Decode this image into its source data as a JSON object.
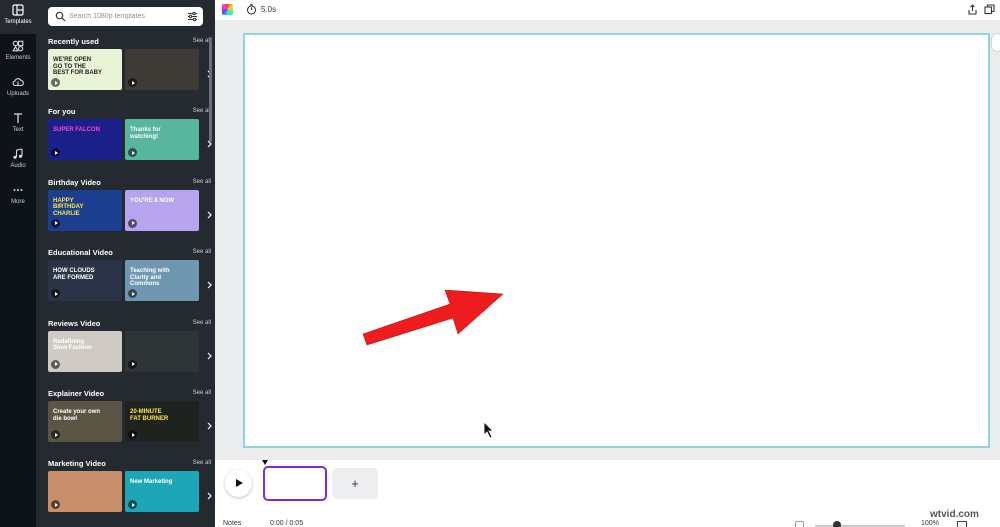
{
  "rail": {
    "items": [
      {
        "label": "Templates",
        "icon": "templates-icon"
      },
      {
        "label": "Elements",
        "icon": "elements-icon"
      },
      {
        "label": "Uploads",
        "icon": "uploads-icon"
      },
      {
        "label": "Text",
        "icon": "text-icon"
      },
      {
        "label": "Audio",
        "icon": "audio-icon"
      },
      {
        "label": "More",
        "icon": "more-icon"
      }
    ]
  },
  "search": {
    "placeholder": "Search 1080p templates"
  },
  "sections": [
    {
      "title": "Recently used",
      "see_all": "See all",
      "thumbs": [
        {
          "text": "WE'RE OPEN\nGO TO THE\nBEST FOR BABY",
          "bg": "#e9f3d6",
          "fg": "#1d1d1d"
        },
        {
          "text": "",
          "bg": "#3e3a36",
          "fg": "#fff"
        }
      ]
    },
    {
      "title": "For you",
      "see_all": "See all",
      "thumbs": [
        {
          "text": "SUPER FALCON",
          "bg": "#1b1f8a",
          "fg": "#ff44c8"
        },
        {
          "text": "Thanks for\nwatching!",
          "bg": "#57b69d",
          "fg": "#ffffff"
        }
      ]
    },
    {
      "title": "Birthday Video",
      "see_all": "See all",
      "thumbs": [
        {
          "text": "HAPPY\nBIRTHDAY\nCHARLIE",
          "bg": "#1b3f8e",
          "fg": "#ffe24a"
        },
        {
          "text": "YOU'RE 8 NOW",
          "bg": "#b6a4ee",
          "fg": "#ffffff"
        }
      ]
    },
    {
      "title": "Educational Video",
      "see_all": "See all",
      "thumbs": [
        {
          "text": "HOW CLOUDS\nARE FORMED",
          "bg": "#2a3446",
          "fg": "#ffffff"
        },
        {
          "text": "Teaching with\nClarity and\nCommons",
          "bg": "#6f98b0",
          "fg": "#ffffff"
        }
      ]
    },
    {
      "title": "Reviews Video",
      "see_all": "See all",
      "thumbs": [
        {
          "text": "Redefining\nSlow Fashion",
          "bg": "#cfcac4",
          "fg": "#ffffff"
        },
        {
          "text": "",
          "bg": "#2f3436",
          "fg": "#ffffff"
        }
      ]
    },
    {
      "title": "Explainer Video",
      "see_all": "See all",
      "thumbs": [
        {
          "text": "Create your own\ndie bowl",
          "bg": "#5a5544",
          "fg": "#ffffff"
        },
        {
          "text": "20-MINUTE\nFAT BURNER",
          "bg": "#1e2320",
          "fg": "#ffe64a"
        }
      ]
    },
    {
      "title": "Marketing Video",
      "see_all": "See all",
      "thumbs": [
        {
          "text": "",
          "bg": "#c98e6a",
          "fg": "#ffffff"
        },
        {
          "text": "New Marketing",
          "bg": "#1fa6b6",
          "fg": "#ffffff"
        }
      ]
    }
  ],
  "topbar": {
    "duration": "5.0s"
  },
  "timeline": {
    "add_label": "+",
    "notes": "Notes",
    "timecode": "0:00 / 0:05",
    "zoom": "100%"
  },
  "watermark": {
    "pre": "wtvid",
    "dot": ".",
    "post": "com"
  },
  "colors": {
    "selection": "#7d2ae8",
    "page_border": "#8fd3dc",
    "arrow": "#ee1c1c",
    "panel": "#252a30",
    "rail": "#0e1318"
  }
}
